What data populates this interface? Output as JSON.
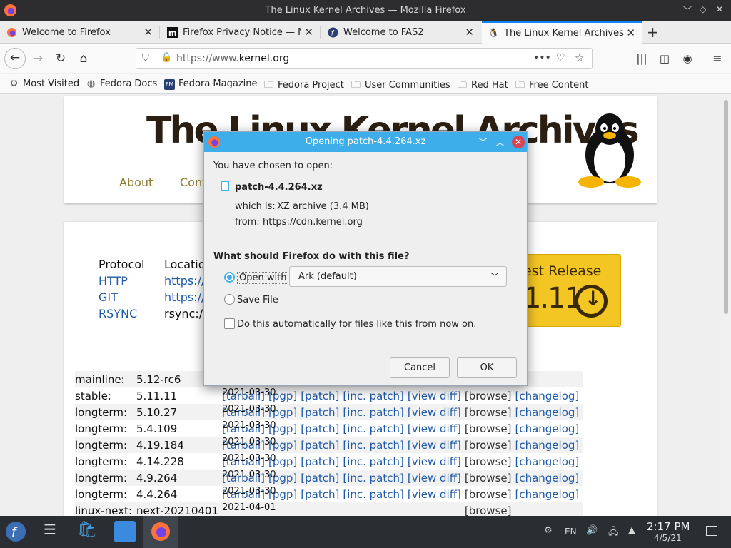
{
  "window": {
    "title": "The Linux Kernel Archives — Mozilla Firefox"
  },
  "tabs": [
    {
      "label": "Welcome to Firefox"
    },
    {
      "label": "Firefox Privacy Notice — M"
    },
    {
      "label": "Welcome to FAS2"
    },
    {
      "label": "The Linux Kernel Archives"
    }
  ],
  "toolbar": {
    "url_prefix": "https://www.",
    "url_domain": "kernel.org",
    "new_tab": "+"
  },
  "bookmarks": [
    "Most Visited",
    "Fedora Docs",
    "Fedora Magazine",
    "Fedora Project",
    "User Communities",
    "Red Hat",
    "Free Content"
  ],
  "page": {
    "title": "The Linux Kernel Archives",
    "menu": [
      "About",
      "Cont"
    ],
    "protocol_header": "Protocol",
    "location_header": "Locatio",
    "protocols": [
      {
        "name": "HTTP",
        "loc": "https://"
      },
      {
        "name": "GIT",
        "loc": "https://"
      },
      {
        "name": "RSYNC",
        "loc": "rsync://"
      }
    ],
    "latest_label": "est Release",
    "latest_version": "1.11",
    "releases": [
      {
        "kind": "mainline:",
        "ver": "5.12-rc6",
        "date": "",
        "links": [],
        "browse": "[browse]",
        "changelog": ""
      },
      {
        "kind": "stable:",
        "ver": "5.11.11",
        "date": "2021-03-30",
        "links": [
          "[tarball]",
          "[pgp]",
          "[patch]",
          "[inc. patch]",
          "[view diff]"
        ],
        "browse": "[browse]",
        "changelog": "[changelog]"
      },
      {
        "kind": "longterm:",
        "ver": "5.10.27",
        "date": "2021-03-30",
        "links": [
          "[tarball]",
          "[pgp]",
          "[patch]",
          "[inc. patch]",
          "[view diff]"
        ],
        "browse": "[browse]",
        "changelog": "[changelog]"
      },
      {
        "kind": "longterm:",
        "ver": "5.4.109",
        "date": "2021-03-30",
        "links": [
          "[tarball]",
          "[pgp]",
          "[patch]",
          "[inc. patch]",
          "[view diff]"
        ],
        "browse": "[browse]",
        "changelog": "[changelog]"
      },
      {
        "kind": "longterm:",
        "ver": "4.19.184",
        "date": "2021-03-30",
        "links": [
          "[tarball]",
          "[pgp]",
          "[patch]",
          "[inc. patch]",
          "[view diff]"
        ],
        "browse": "[browse]",
        "changelog": "[changelog]"
      },
      {
        "kind": "longterm:",
        "ver": "4.14.228",
        "date": "2021-03-30",
        "links": [
          "[tarball]",
          "[pgp]",
          "[patch]",
          "[inc. patch]",
          "[view diff]"
        ],
        "browse": "[browse]",
        "changelog": "[changelog]"
      },
      {
        "kind": "longterm:",
        "ver": "4.9.264",
        "date": "2021-03-30",
        "links": [
          "[tarball]",
          "[pgp]",
          "[patch]",
          "[inc. patch]",
          "[view diff]"
        ],
        "browse": "[browse]",
        "changelog": "[changelog]"
      },
      {
        "kind": "longterm:",
        "ver": "4.4.264",
        "date": "2021-03-30",
        "links": [
          "[tarball]",
          "[pgp]",
          "[patch]",
          "[inc. patch]",
          "[view diff]"
        ],
        "browse": "[browse]",
        "changelog": "[changelog]"
      },
      {
        "kind": "linux-next:",
        "ver": "next-20210401",
        "date": "2021-04-01",
        "links": [],
        "browse": "[browse]",
        "changelog": ""
      }
    ]
  },
  "dialog": {
    "title": "Opening patch-4.4.264.xz",
    "chosen": "You have chosen to open:",
    "filename": "patch-4.4.264.xz",
    "which_is_label": "which is:",
    "which_is_value": "XZ archive (3.4 MB)",
    "from_label": "from:",
    "from_value": "https://cdn.kernel.org",
    "question": "What should Firefox do with this file?",
    "open_with": "Open with",
    "app": "Ark (default)",
    "save_file": "Save File",
    "auto": "Do this automatically for files like this from now on.",
    "cancel": "Cancel",
    "ok": "OK"
  },
  "taskbar": {
    "lang": "EN",
    "time": "2:17 PM",
    "date": "4/5/21"
  },
  "colors": {
    "accent": "#3daee9",
    "link": "#1f5aa8",
    "latest": "#f4c624",
    "taskbar": "#2a2e32"
  }
}
